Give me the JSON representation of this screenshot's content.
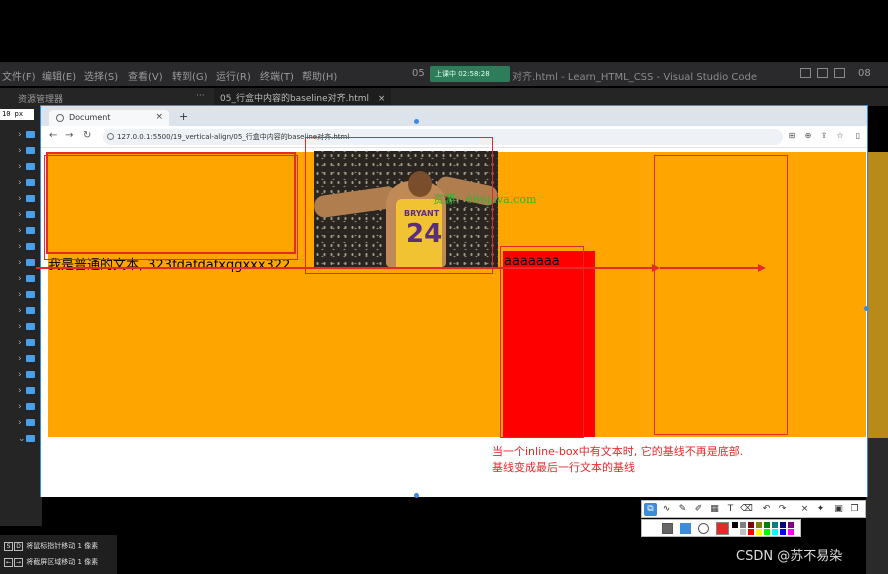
{
  "vscode": {
    "menu": [
      "文件(F)",
      "编辑(E)",
      "选择(S)",
      "查看(V)",
      "转到(G)",
      "运行(R)",
      "终端(T)",
      "帮助(H)"
    ],
    "recording_badge": "上课中 02:58:28",
    "title_fragment_left": "05",
    "window_title": "对齐.html - Learn_HTML_CSS - Visual Studio Code",
    "explorer_label": "资源管理器",
    "more_label": "···",
    "active_tab": "05_行盒中内容的baseline对齐.html",
    "tab_close": "×",
    "zoom_tag": "10 px",
    "corner_counter": "08"
  },
  "browser": {
    "tab_title": "Document",
    "tab_close": "×",
    "new_tab": "+",
    "url": "127.0.0.1:5500/19_vertical-align/05_行盒中内容的baseline对齐.html",
    "nav": {
      "back": "←",
      "forward": "→",
      "reload": "↻"
    }
  },
  "page": {
    "plain_text": "我是普通的文本, 323fdafdafxqgxxx322",
    "inline_text": "aaaaaaa",
    "watermark": "资源：666java.com",
    "jersey_name": "BRYANT",
    "jersey_number": "24"
  },
  "annotation": {
    "line1": "当一个inline-box中有文本时, 它的基线不再是底部.",
    "line2": "基线变成最后一行文本的基线",
    "color": "#e62a2a"
  },
  "hints": {
    "row1": "将鼠标指针移动 1 像素",
    "row2": "将截屏区域移动 1 像素",
    "keys1": [
      "S",
      "D"
    ],
    "keys2": [
      "←",
      "→"
    ]
  },
  "credit": "CSDN @苏不易染",
  "colors": {
    "orange": "#ffa500",
    "red": "#ff0000",
    "selection": "#3d8bd9",
    "palette": [
      "#000000",
      "#808080",
      "#800000",
      "#808000",
      "#008000",
      "#008080",
      "#000080",
      "#800080",
      "#ffffff",
      "#c0c0c0",
      "#ff0000",
      "#ffff00",
      "#00ff00",
      "#00ffff",
      "#0000ff",
      "#ff00ff"
    ]
  }
}
